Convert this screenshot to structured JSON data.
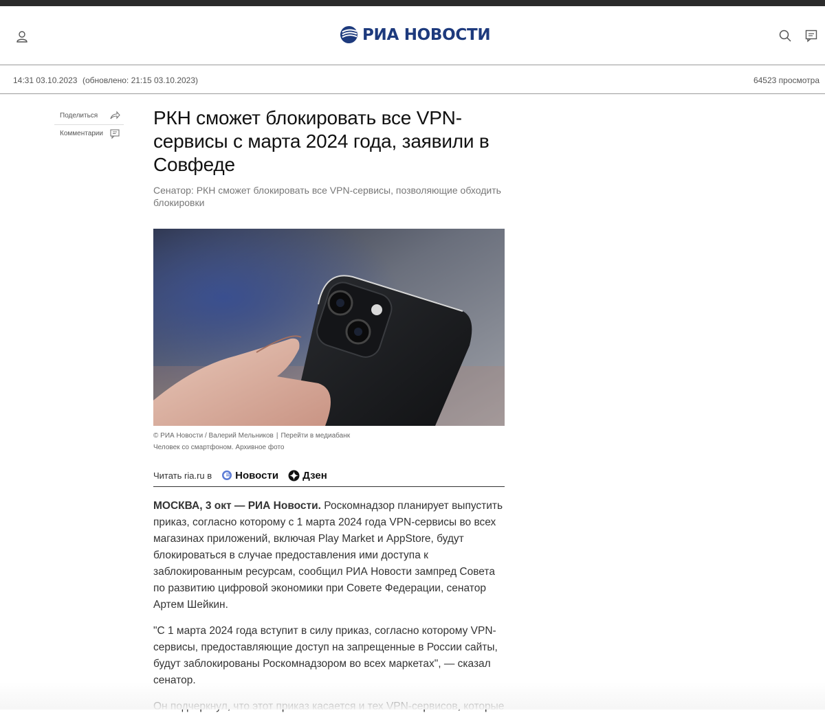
{
  "header": {
    "logo_text": "РИА НОВОСТИ",
    "brand_color": "#1d3a7d",
    "icons": [
      "user-icon",
      "search-icon",
      "comments-icon"
    ]
  },
  "meta": {
    "date": "14:31 03.10.2023",
    "updated": "(обновлено: 21:15 03.10.2023)",
    "views": "64523 просмотра"
  },
  "side": {
    "share_label": "Поделиться",
    "comments_label": "Комментарии"
  },
  "article": {
    "title": "РКН сможет блокировать все VPN-сервисы с марта 2024 года, заявили в Совфеде",
    "subtitle": "Сенатор: РКН сможет блокировать все VPN-сервисы, позволяющие обходить блокировки",
    "photo_credit": "© РИА Новости / Валерий Мельников",
    "photo_link": "Перейти в медиабанк",
    "photo_caption": "Человек со смартфоном. Архивное фото",
    "read_in_label": "Читать ria.ru в",
    "news_label": "Новости",
    "dzen_label": "Дзен",
    "dateline": "МОСКВА, 3 окт — РИА Новости.",
    "p1": "Роскомнадзор планирует выпустить приказ, согласно которому с 1 марта 2024 года VPN-сервисы во всех магазинах приложений, включая Play Market и AppStore, будут блокироваться в случае предоставления ими доступа к заблокированным ресурсам, сообщил РИА Новости зампред Совета по развитию цифровой экономики при Совете Федерации, сенатор Артем Шейкин.",
    "p2": "\"С 1 марта 2024 года вступит в силу приказ, согласно которому VPN-сервисы, предоставляющие доступ на запрещенные в России сайты, будут заблокированы Роскомнадзором во всех маркетах\", — сказал сенатор.",
    "p3": "Он подчеркнул, что этот приказ касается и тех VPN-сервисов, которые"
  }
}
